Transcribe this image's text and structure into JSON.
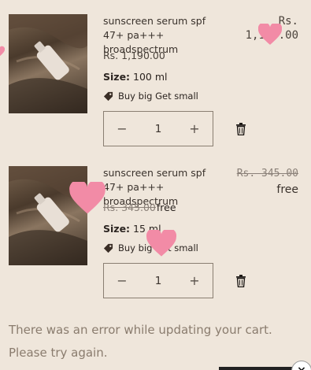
{
  "items": [
    {
      "title": "sunscreen serum spf 47+ pa+++ broadspectrum",
      "price_right_line1": "Rs.",
      "price_right_line2": "1,190.00",
      "unit_price": "Rs. 1,190.00",
      "size_label": "Size:",
      "size_value": "100 ml",
      "discount": "Buy big Get small",
      "quantity": "1"
    },
    {
      "title": "sunscreen serum spf 47+ pa+++ broadspectrum",
      "price_right_strike": "Rs. 345.00",
      "price_right_final": "free",
      "unit_price_strike": "Rs. 345.00",
      "unit_price_final": "free",
      "size_label": "Size:",
      "size_value": "15 ml",
      "discount": "Buy big Get small",
      "quantity": "1"
    }
  ],
  "controls": {
    "decrease": "−",
    "increase": "+"
  },
  "error": "There was an error while updating your cart. Please try again.",
  "overlay": {
    "close": "×"
  },
  "icons": {
    "tag": "tag-icon",
    "trash": "trash-icon",
    "heart": "heart-icon"
  },
  "colors": {
    "background": "#efe6db",
    "heart": "#f28ba6",
    "error_text": "#8a7c6e"
  }
}
